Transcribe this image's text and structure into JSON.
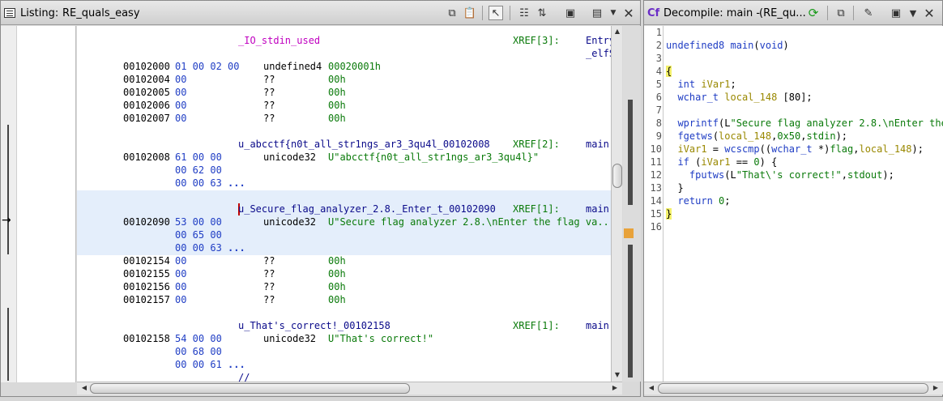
{
  "listing": {
    "title_prefix": "Listing:",
    "title_program": "RE_quals_easy",
    "rows": [
      {
        "type": "label",
        "label": "_IO_stdin_used",
        "xref": "XREF[3]:",
        "xref_to": "Entry",
        "style": "magenta"
      },
      {
        "type": "cont",
        "xref_to": "_elfS"
      },
      {
        "type": "data",
        "addr": "00102000",
        "bytes": "01 00 02 00",
        "mnem": "undefined4",
        "opnd": "00020001h"
      },
      {
        "type": "data",
        "addr": "00102004",
        "bytes": "00",
        "mnem": "??",
        "opnd": "00h"
      },
      {
        "type": "data",
        "addr": "00102005",
        "bytes": "00",
        "mnem": "??",
        "opnd": "00h"
      },
      {
        "type": "data",
        "addr": "00102006",
        "bytes": "00",
        "mnem": "??",
        "opnd": "00h"
      },
      {
        "type": "data",
        "addr": "00102007",
        "bytes": "00",
        "mnem": "??",
        "opnd": "00h"
      },
      {
        "type": "blank"
      },
      {
        "type": "label",
        "label": "u_abcctf{n0t_all_str1ngs_ar3_3qu4l_00102008",
        "xref": "XREF[2]:",
        "xref_to": "main"
      },
      {
        "type": "data",
        "addr": "00102008",
        "bytes": "61 00 00",
        "mnem": "unicode32",
        "opnd": "U\"abcctf{n0t_all_str1ngs_ar3_3qu4l}\""
      },
      {
        "type": "bytes",
        "bytes": "00 62 00"
      },
      {
        "type": "bytes",
        "bytes": "00 00 63",
        "ellipsis": "..."
      },
      {
        "type": "blank"
      },
      {
        "type": "label",
        "label": "u_Secure_flag_analyzer_2.8._Enter_t_00102090",
        "xref": "XREF[1]:",
        "xref_to": "main"
      },
      {
        "type": "data",
        "addr": "00102090",
        "bytes": "53 00 00",
        "mnem": "unicode32",
        "opnd": "U\"Secure flag analyzer 2.8.\\nEnter the flag va..."
      },
      {
        "type": "bytes",
        "bytes": "00 65 00"
      },
      {
        "type": "bytes",
        "bytes": "00 00 63",
        "ellipsis": "..."
      },
      {
        "type": "data",
        "addr": "00102154",
        "bytes": "00",
        "mnem": "??",
        "opnd": "00h"
      },
      {
        "type": "data",
        "addr": "00102155",
        "bytes": "00",
        "mnem": "??",
        "opnd": "00h"
      },
      {
        "type": "data",
        "addr": "00102156",
        "bytes": "00",
        "mnem": "??",
        "opnd": "00h"
      },
      {
        "type": "data",
        "addr": "00102157",
        "bytes": "00",
        "mnem": "??",
        "opnd": "00h"
      },
      {
        "type": "blank"
      },
      {
        "type": "label",
        "label": "u_That's_correct!_00102158",
        "xref": "XREF[1]:",
        "xref_to": "main"
      },
      {
        "type": "data",
        "addr": "00102158",
        "bytes": "54 00 00",
        "mnem": "unicode32",
        "opnd": "U\"That's correct!\""
      },
      {
        "type": "bytes",
        "bytes": "00 68 00"
      },
      {
        "type": "bytes",
        "bytes": "00 00 61",
        "ellipsis": "..."
      },
      {
        "type": "comment",
        "text": "//"
      }
    ]
  },
  "decompile": {
    "title_prefix": "Decompile: main -",
    "title_program": "(RE_qu...",
    "lines": [
      {
        "n": "1",
        "parts": []
      },
      {
        "n": "2",
        "parts": [
          {
            "t": "undefined8",
            "c": "ty"
          },
          {
            "t": " ",
            "c": ""
          },
          {
            "t": "main",
            "c": "fn"
          },
          {
            "t": "(",
            "c": ""
          },
          {
            "t": "void",
            "c": "ty"
          },
          {
            "t": ")",
            "c": ""
          }
        ]
      },
      {
        "n": "3",
        "parts": []
      },
      {
        "n": "4",
        "parts": [
          {
            "t": "{",
            "c": "brace-hl"
          }
        ]
      },
      {
        "n": "5",
        "parts": [
          {
            "t": "  ",
            "c": ""
          },
          {
            "t": "int",
            "c": "ty"
          },
          {
            "t": " ",
            "c": ""
          },
          {
            "t": "iVar1",
            "c": "lvar"
          },
          {
            "t": ";",
            "c": ""
          }
        ]
      },
      {
        "n": "6",
        "parts": [
          {
            "t": "  ",
            "c": ""
          },
          {
            "t": "wchar_t",
            "c": "ty"
          },
          {
            "t": " ",
            "c": ""
          },
          {
            "t": "local_148",
            "c": "lvar"
          },
          {
            "t": " [80];",
            "c": ""
          }
        ]
      },
      {
        "n": "7",
        "parts": []
      },
      {
        "n": "8",
        "parts": [
          {
            "t": "  ",
            "c": ""
          },
          {
            "t": "wprintf",
            "c": "fn"
          },
          {
            "t": "(L",
            "c": ""
          },
          {
            "t": "\"Secure flag analyzer 2.8.\\nEnter the",
            "c": "str"
          }
        ]
      },
      {
        "n": "9",
        "parts": [
          {
            "t": "  ",
            "c": ""
          },
          {
            "t": "fgetws",
            "c": "fn"
          },
          {
            "t": "(",
            "c": ""
          },
          {
            "t": "local_148",
            "c": "lvar"
          },
          {
            "t": ",",
            "c": ""
          },
          {
            "t": "0x50",
            "c": "num"
          },
          {
            "t": ",",
            "c": ""
          },
          {
            "t": "stdin",
            "c": "gl"
          },
          {
            "t": ");",
            "c": ""
          }
        ]
      },
      {
        "n": "10",
        "parts": [
          {
            "t": "  ",
            "c": ""
          },
          {
            "t": "iVar1",
            "c": "lvar"
          },
          {
            "t": " = ",
            "c": ""
          },
          {
            "t": "wcscmp",
            "c": "fn"
          },
          {
            "t": "((",
            "c": ""
          },
          {
            "t": "wchar_t",
            "c": "ty"
          },
          {
            "t": " *)",
            "c": ""
          },
          {
            "t": "flag",
            "c": "gl"
          },
          {
            "t": ",",
            "c": ""
          },
          {
            "t": "local_148",
            "c": "lvar"
          },
          {
            "t": ");",
            "c": ""
          }
        ]
      },
      {
        "n": "11",
        "parts": [
          {
            "t": "  ",
            "c": ""
          },
          {
            "t": "if",
            "c": "kw"
          },
          {
            "t": " (",
            "c": ""
          },
          {
            "t": "iVar1",
            "c": "lvar"
          },
          {
            "t": " == ",
            "c": ""
          },
          {
            "t": "0",
            "c": "num"
          },
          {
            "t": ") {",
            "c": ""
          }
        ]
      },
      {
        "n": "12",
        "parts": [
          {
            "t": "    ",
            "c": ""
          },
          {
            "t": "fputws",
            "c": "fn"
          },
          {
            "t": "(L",
            "c": ""
          },
          {
            "t": "\"That\\'s correct!\"",
            "c": "str"
          },
          {
            "t": ",",
            "c": ""
          },
          {
            "t": "stdout",
            "c": "gl"
          },
          {
            "t": ");",
            "c": ""
          }
        ]
      },
      {
        "n": "13",
        "parts": [
          {
            "t": "  }",
            "c": ""
          }
        ]
      },
      {
        "n": "14",
        "parts": [
          {
            "t": "  ",
            "c": ""
          },
          {
            "t": "return",
            "c": "kw"
          },
          {
            "t": " ",
            "c": ""
          },
          {
            "t": "0",
            "c": "num"
          },
          {
            "t": ";",
            "c": ""
          }
        ]
      },
      {
        "n": "15",
        "parts": [
          {
            "t": "}",
            "c": "brace-hl"
          }
        ]
      },
      {
        "n": "16",
        "parts": []
      }
    ]
  },
  "icons": {
    "listing_toolbar": [
      "copy-icon",
      "paste-icon",
      "cursor-select-icon",
      "field-edit-icon",
      "diff-icon",
      "snapshot-icon",
      "layout-icon",
      "menu-dropdown-icon",
      "close-icon"
    ],
    "decompile_toolbar": [
      "refresh-icon",
      "copy-icon",
      "edit-icon",
      "snapshot-icon",
      "menu-dropdown-icon",
      "close-icon"
    ]
  },
  "colors": {
    "address_bytes": "#1f3dc4",
    "string_green": "#0a7a0a",
    "label_magenta": "#c000c0",
    "selection_bg": "#e4eefb",
    "brace_highlight": "#f3f06a"
  }
}
